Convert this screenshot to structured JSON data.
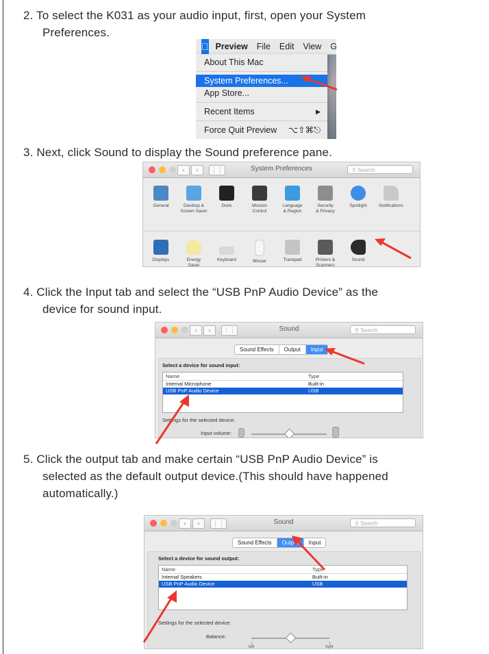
{
  "steps": [
    {
      "line1": "2. To select the K031 as your audio input, first, open your System",
      "line2": "Preferences."
    },
    {
      "line1": "3. Next, click Sound to display the Sound preference pane.",
      "line2": ""
    },
    {
      "line1": "4. Click the Input tab and select the “USB PnP Audio Device”  as the",
      "line2": "device for sound input."
    },
    {
      "line1": "5. Click the output tab and make certain “USB PnP Audio Device”  is",
      "line2": "selected as the default output device.(This should have happened",
      "line3": "automatically.)"
    }
  ],
  "menu": {
    "bar": [
      "Preview",
      "File",
      "Edit",
      "View",
      "Go"
    ],
    "items": [
      "About This Mac",
      "System Preferences...",
      "App Store...",
      "Recent Items",
      "Force Quit Preview"
    ],
    "recent_arrow": "▶",
    "force_quit_shortcut": "⌥⇧⌘⎋"
  },
  "prefs": {
    "title": "System Preferences",
    "search": "Search",
    "row1": [
      "General",
      "Desktop &\nScreen Saver",
      "Dock",
      "Mission\nControl",
      "Language\n& Region",
      "Security\n& Privacy",
      "Spotlight",
      "Notifications"
    ],
    "row2": [
      "Displays",
      "Energy\nSaver",
      "Keyboard",
      "Mouse",
      "Trackpad",
      "Printers &\nScanners",
      "Sound"
    ]
  },
  "sound_input": {
    "title": "Sound",
    "search": "Search",
    "tabs": [
      "Sound Effects",
      "Output",
      "Input"
    ],
    "select_label": "Select a device for sound input:",
    "col_name": "Name",
    "col_type": "Type",
    "rows": [
      {
        "name": "Internal Microphone",
        "type": "Built-in"
      },
      {
        "name": "USB PnP Audio Device",
        "type": "USB"
      }
    ],
    "settings_label": "Settings for the selected device:",
    "volume_label": "Input volume:",
    "volume_level": 0.5
  },
  "sound_output": {
    "title": "Sound",
    "search": "Search",
    "tabs": [
      "Sound Effects",
      "Output",
      "Input"
    ],
    "select_label": "Select a device for sound output:",
    "col_name": "Name",
    "col_type": "Type",
    "rows": [
      {
        "name": "Internal Speakers",
        "type": "Built-in"
      },
      {
        "name": "USB PnP Audio Device",
        "type": "USB"
      }
    ],
    "settings_label": "Settings for the selected device:",
    "balance_label": "Balance:",
    "left": "left",
    "right": "right",
    "balance_level": 0.5
  },
  "colors": {
    "highlight": "#1661d6",
    "arrow": "#e8392e"
  }
}
